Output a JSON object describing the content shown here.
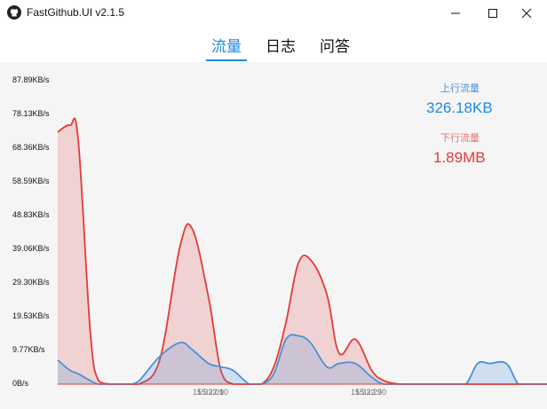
{
  "window": {
    "title": "FastGithub.UI v2.1.5",
    "icon": "github-icon",
    "controls": [
      "minimize-icon",
      "maximize-icon",
      "close-icon"
    ]
  },
  "tabs": [
    {
      "label": "流量",
      "active": true
    },
    {
      "label": "日志",
      "active": false
    },
    {
      "label": "问答",
      "active": false
    }
  ],
  "stats": {
    "upload_label": "上行流量",
    "upload_value": "326.18KB",
    "download_label": "下行流量",
    "download_value": "1.89MB"
  },
  "colors": {
    "accent": "#1e88e5",
    "upload": "#4a90d9",
    "download": "#e53935"
  },
  "chart_data": {
    "type": "area",
    "y_unit": "KB/s",
    "ylim": [
      0,
      87.89
    ],
    "y_tick_labels": [
      "87.89KB/s",
      "78.13KB/s",
      "68.36KB/s",
      "58.59KB/s",
      "48.83KB/s",
      "39.06KB/s",
      "29.30KB/s",
      "19.53KB/s",
      "9.77KB/s",
      "0B/s"
    ],
    "x_tick_labels": [
      "15:32:09",
      "15:32:10",
      "15:32:29",
      "15:32:30"
    ],
    "grid": false,
    "series": [
      {
        "name": "下行流量",
        "color": "#e53935",
        "x": [
          0,
          3,
          5,
          8,
          10,
          13,
          16,
          18,
          20,
          25,
          30,
          33,
          37,
          40,
          43,
          47,
          50,
          53,
          56,
          59,
          62,
          66,
          69,
          73,
          77,
          80,
          84,
          88,
          92,
          96,
          100,
          103,
          106,
          110,
          113,
          116,
          120
        ],
        "y": [
          73,
          75,
          71,
          15,
          1,
          0,
          0,
          0,
          0,
          7,
          40,
          45,
          25,
          4,
          0,
          0,
          0,
          5,
          18,
          35,
          36,
          26,
          9,
          13,
          4,
          1,
          0,
          0,
          0,
          0,
          0,
          0,
          0,
          0,
          0,
          0,
          0
        ]
      },
      {
        "name": "上行流量",
        "color": "#4a90d9",
        "x": [
          0,
          3,
          5,
          8,
          10,
          13,
          16,
          18,
          20,
          25,
          30,
          33,
          37,
          40,
          43,
          47,
          50,
          53,
          56,
          59,
          62,
          66,
          69,
          73,
          77,
          80,
          84,
          88,
          92,
          96,
          100,
          103,
          106,
          110,
          113,
          116,
          120
        ],
        "y": [
          7,
          4,
          3,
          1,
          0,
          0,
          0,
          0,
          1,
          8,
          12,
          10,
          6,
          5,
          4,
          0,
          0,
          3,
          13,
          14,
          12,
          5,
          6,
          6,
          2,
          0,
          0,
          0,
          0,
          0,
          0,
          6,
          6,
          6,
          0,
          0,
          0
        ]
      }
    ]
  }
}
